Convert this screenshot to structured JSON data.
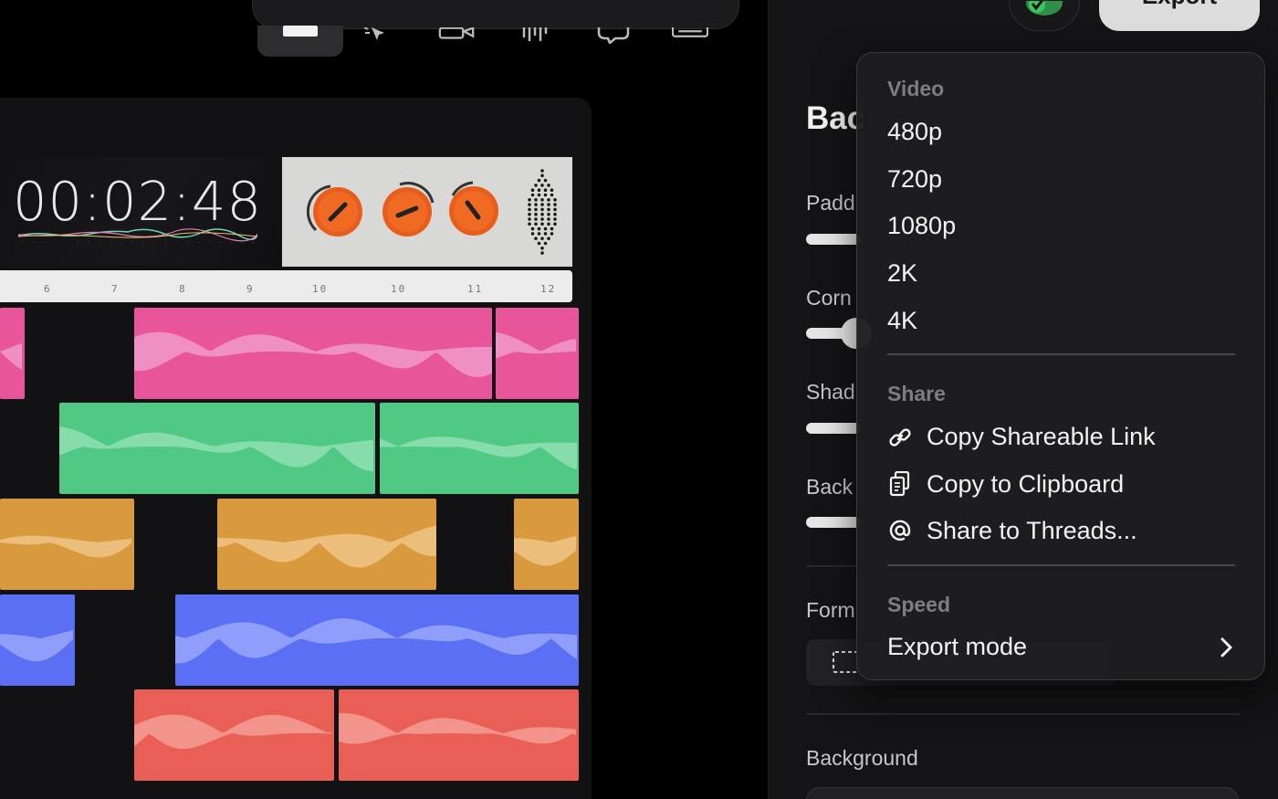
{
  "toolbar": {
    "tools": [
      "image-tool",
      "cursor-tool",
      "camera-tool",
      "audio-tool",
      "comment-tool",
      "keyboard-tool"
    ]
  },
  "canvas": {
    "timecode": "00:02:48",
    "ruler_ticks": [
      "6",
      "7",
      "8",
      "9",
      "10",
      "10",
      "11",
      "12"
    ],
    "knob_color": "#e85d1c",
    "tracks": [
      {
        "color": "#e8559b",
        "wave_color": "#f19acb"
      },
      {
        "color": "#4fc983",
        "wave_color": "#8fdfb1"
      },
      {
        "color": "#d99a3d",
        "wave_color": "#eec486"
      },
      {
        "color": "#5b6ff5",
        "wave_color": "#9aa7fb"
      },
      {
        "color": "#ea5f55",
        "wave_color": "#f59d97"
      }
    ]
  },
  "sidebar": {
    "title": "Bac",
    "padding_label": "Padd",
    "corner_label": "Corn",
    "shadow_label": "Shad",
    "background_label_short": "Back",
    "format_label": "Form",
    "background_label": "Background"
  },
  "header": {
    "export_label": "Export"
  },
  "menu": {
    "video_header": "Video",
    "video_items": [
      "480p",
      "720p",
      "1080p",
      "2K",
      "4K"
    ],
    "share_header": "Share",
    "share_items": [
      {
        "label": "Copy Shareable Link",
        "icon": "link-icon"
      },
      {
        "label": "Copy to Clipboard",
        "icon": "clipboard-icon"
      },
      {
        "label": "Share to Threads...",
        "icon": "threads-icon"
      }
    ],
    "speed_header": "Speed",
    "export_mode_label": "Export mode"
  }
}
